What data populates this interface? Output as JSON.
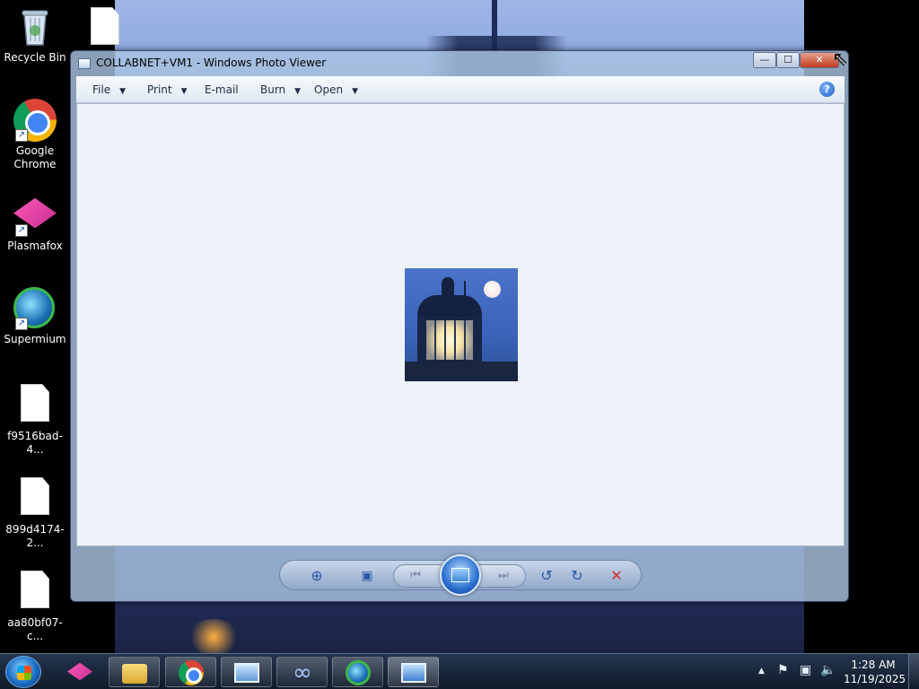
{
  "desktop": {
    "icons": [
      {
        "label": "Recycle Bin"
      },
      {
        "label": "Google Chrome"
      },
      {
        "label": "Plasmafox"
      },
      {
        "label": "Supermium"
      },
      {
        "label": "f9516bad-4..."
      },
      {
        "label": "899d4174-2..."
      },
      {
        "label": "aa80bf07-c..."
      }
    ]
  },
  "window": {
    "title": "COLLABNET+VM1 - Windows Photo Viewer",
    "controls": {
      "minimize": "—",
      "maximize": "☐",
      "close": "✕"
    },
    "menu": {
      "file": "File",
      "print": "Print",
      "email": "E-mail",
      "burn": "Burn",
      "open": "Open"
    },
    "help_glyph": "?",
    "toolbar": {
      "zoom_glyph": "⊕",
      "fit_glyph": "▣",
      "prev_glyph": "⏮",
      "next_glyph": "⏭",
      "rotate_ccw_glyph": "↺",
      "rotate_cw_glyph": "↻",
      "delete_glyph": "✕"
    }
  },
  "taskbar": {
    "clock_time": "1:28 AM",
    "clock_date": "11/19/2025",
    "tray_glyphs": {
      "expand": "▲",
      "flag": "⚑",
      "network": "▣",
      "volume": "🔈"
    }
  },
  "colors": {
    "delete_red": "#d42a2a",
    "accent_blue": "#2a6fd0"
  }
}
